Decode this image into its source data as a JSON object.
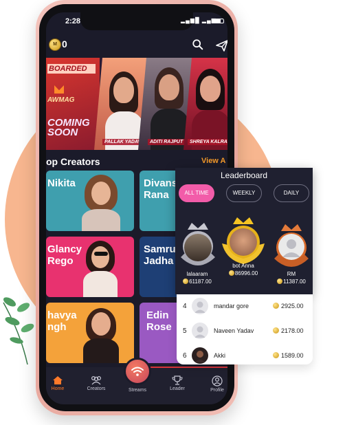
{
  "status_bar": {
    "time": "2:28",
    "icons": "⚙ ✉ ▕▏▐█"
  },
  "header": {
    "coin_symbol": "M",
    "coin_count": "0"
  },
  "banner": {
    "tag": "BOARDED",
    "brand": "AWMAG",
    "coming": "COMING\nSOON",
    "names": [
      "PALLAK YADAV",
      "ADITI RAJPUT",
      "SHREYA KALRA"
    ]
  },
  "section": {
    "title": "op Creators",
    "view_all": "View A"
  },
  "creators": [
    {
      "name": "Nikita",
      "bg": "#3f9fae"
    },
    {
      "name": "Divans\nRana",
      "bg": "#3f9fae"
    },
    {
      "name": "Glancy\nRego",
      "bg": "#e8326f"
    },
    {
      "name": "Samru\nJadha",
      "bg": "#1e3f75"
    },
    {
      "name": "havya\nngh",
      "bg": "#f4a23a"
    },
    {
      "name": "Edin\nRose",
      "bg": "#9a59c2"
    }
  ],
  "nav": {
    "home": "Home",
    "creators": "Creators",
    "streams": "Streams",
    "leader": "Leader",
    "profile": "Profile"
  },
  "leaderboard": {
    "title": "Leaderboard",
    "tabs": [
      "ALL TIME",
      "WEEKLY",
      "DAILY"
    ],
    "podium": [
      {
        "name": "lalaaram",
        "score": "61187.00"
      },
      {
        "name": "bot Anna",
        "score": "86996.00"
      },
      {
        "name": "RM",
        "score": "11387.00"
      }
    ],
    "rows": [
      {
        "rank": "4",
        "name": "mandar gore",
        "score": "2925.00"
      },
      {
        "rank": "5",
        "name": "Naveen Yadav",
        "score": "2178.00"
      },
      {
        "rank": "6",
        "name": "Akki",
        "score": "1589.00"
      }
    ]
  },
  "colors": {
    "accent_orange": "#f59a2a",
    "accent_pink": "#f25ca9",
    "nav_active": "#ff7a2a"
  }
}
